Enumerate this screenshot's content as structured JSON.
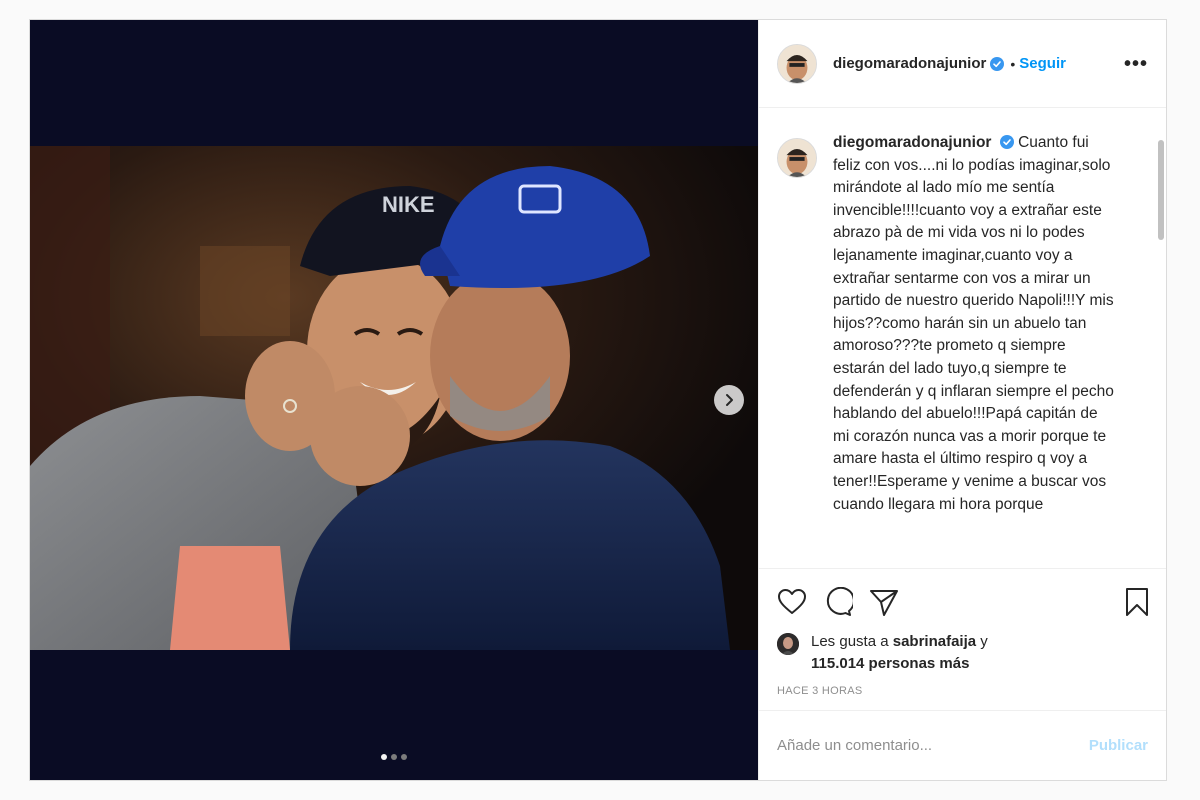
{
  "post": {
    "author": {
      "username": "diegomaradonajunior",
      "verified": true
    },
    "follow_label": "Seguir",
    "separator": "•",
    "more_label": "•••",
    "caption": "Cuanto fui feliz con vos....ni lo podías imaginar,solo mirándote al lado mío me sentía invencible!!!!cuanto voy a extrañar este abrazo pà de mi vida vos ni lo podes lejanamente imaginar,cuanto voy a extrañar sentarme con vos a mirar un partido de nuestro querido Napoli!!!Y mis hijos??como harán sin un abuelo tan amoroso???te prometo q siempre estarán del lado tuyo,q siempre te defenderán y q inflaran siempre el pecho hablando del abuelo!!!Papá capitán de mi corazón nunca vas a morir porque te amare hasta el último respiro q voy a tener!!Esperame y venime a buscar vos cuando llegara mi hora porque",
    "likes": {
      "prefix": "Les gusta a",
      "liker": "sabrinafaija",
      "connector": "y",
      "others": "115.014 personas más"
    },
    "timestamp": "Hace 3 horas",
    "carousel": {
      "total": 3,
      "active": 1
    },
    "comment_input": {
      "placeholder": "Añade un comentario..."
    },
    "publish_label": "Publicar"
  },
  "icons": {
    "like": "heart-icon",
    "comment": "comment-icon",
    "share": "paper-plane-icon",
    "save": "bookmark-icon",
    "verified": "verified-badge-icon",
    "next": "chevron-right-icon"
  },
  "colors": {
    "link_blue": "#0095f6",
    "publish_disabled": "#b2dffc",
    "verified_blue": "#3897f0",
    "meta_gray": "#8e8e8e",
    "media_bg": "#0a0c24"
  }
}
